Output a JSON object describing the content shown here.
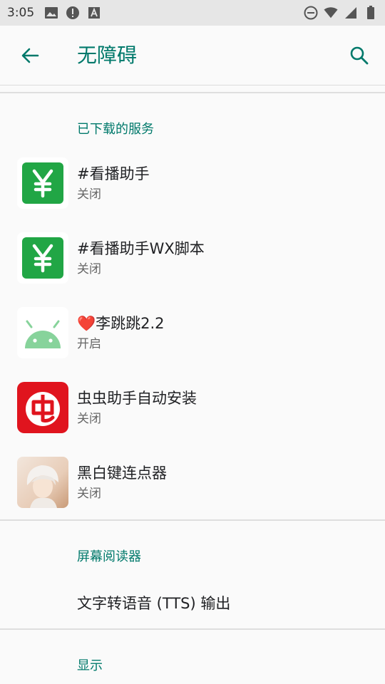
{
  "status_bar": {
    "time": "3:05",
    "left_icons": [
      "image-icon",
      "alert-icon",
      "keyboard-a-icon"
    ],
    "right_icons": [
      "do-not-disturb-icon",
      "wifi-icon",
      "signal-icon",
      "battery-icon"
    ]
  },
  "app_bar": {
    "title": "无障碍",
    "accent_color": "#00796b"
  },
  "downloaded_services": {
    "header": "已下载的服务",
    "items": [
      {
        "title": "#看播助手",
        "status": "关闭",
        "icon": "yen-icon"
      },
      {
        "title": "#看播助手WX脚本",
        "status": "关闭",
        "icon": "yen-icon"
      },
      {
        "title": "❤️李跳跳2.2",
        "status": "开启",
        "icon": "android-icon"
      },
      {
        "title": "虫虫助手自动安装",
        "status": "关闭",
        "icon": "chongchong-icon"
      },
      {
        "title": "黑白键连点器",
        "status": "关闭",
        "icon": "anime-avatar-icon"
      }
    ]
  },
  "screen_reader": {
    "header": "屏幕阅读器",
    "tts_label": "文字转语音 (TTS) 输出"
  },
  "display": {
    "header": "显示"
  }
}
